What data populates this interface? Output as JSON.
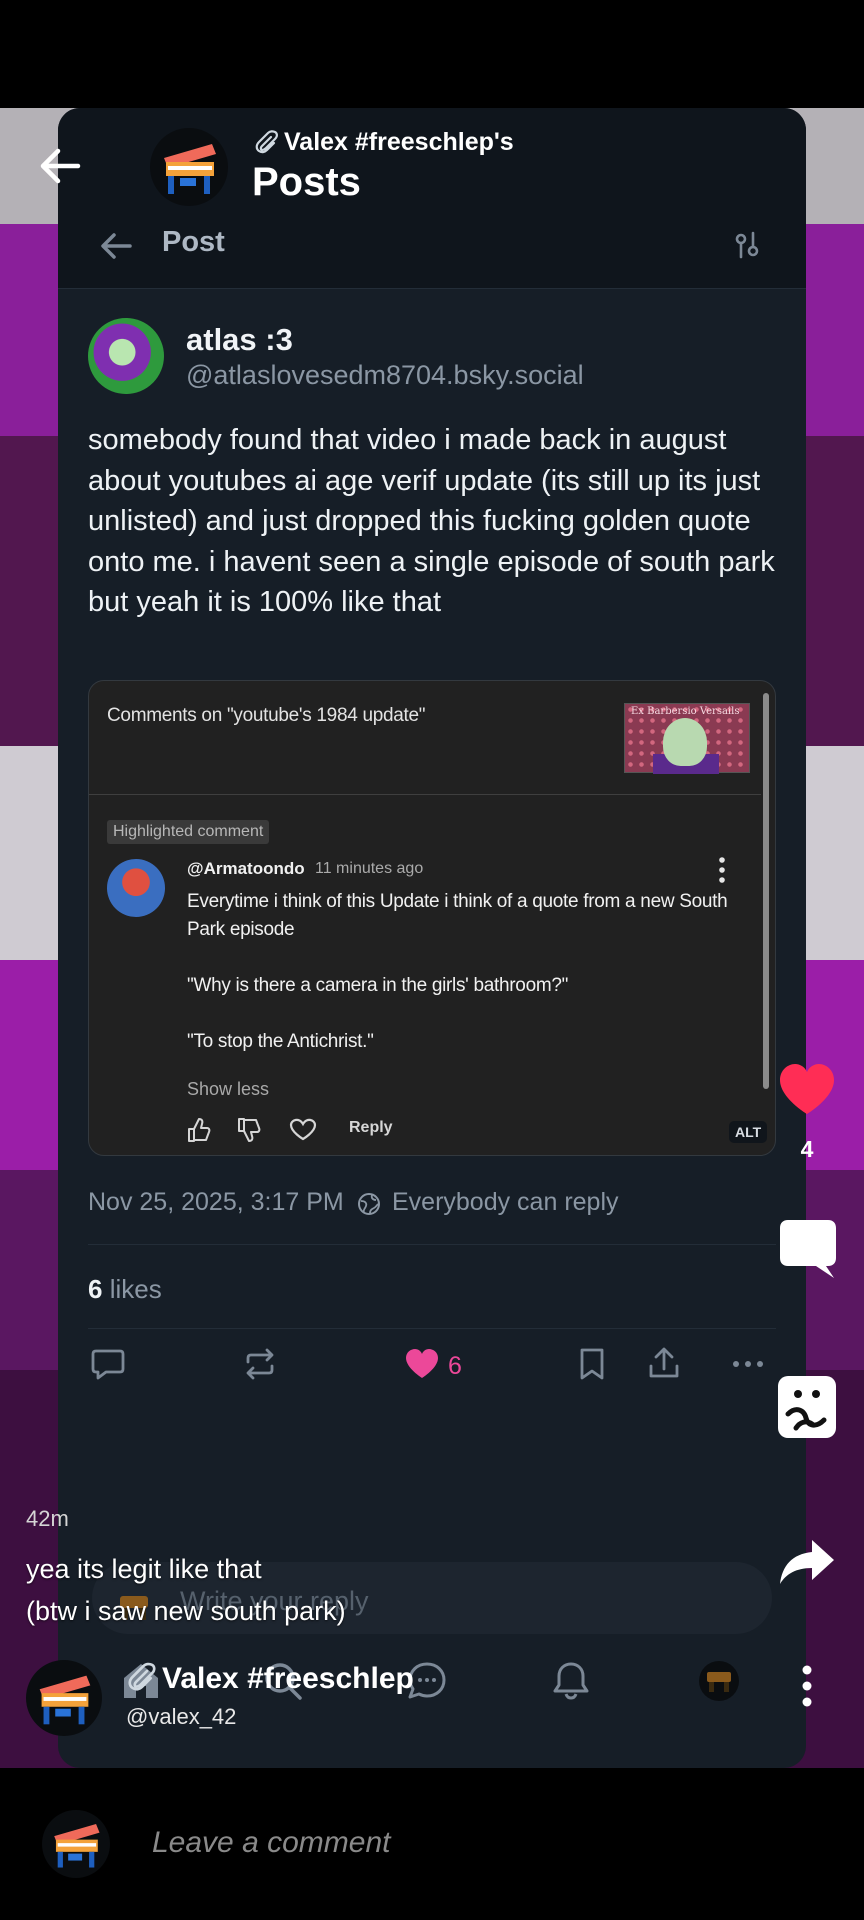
{
  "header": {
    "account_name": "Valex #freeschlep's",
    "title": "Posts"
  },
  "post_view": {
    "nav_title": "Post",
    "author": {
      "name": "atlas :3",
      "handle": "@atlaslovesedm8704.bsky.social"
    },
    "text": "somebody found that video i made back in august about youtubes ai age verif update (its still up its just unlisted) and just dropped this fucking golden quote onto me. i havent seen a single episode of south park but yeah it is 100% like that",
    "embed": {
      "header": "Comments on \"youtube's 1984 update\"",
      "thumb_text": "Ex Barbersio Versails",
      "badge": "Highlighted comment",
      "comment_author": "@Armatoondo",
      "comment_time": "11 minutes ago",
      "comment_lines": [
        "Everytime i think of this Update i think of a quote from a new South Park episode",
        "\"Why is there a camera in the girls' bathroom?\"",
        "\"To stop the Antichrist.\""
      ],
      "show_less": "Show less",
      "reply_label": "Reply",
      "alt_label": "ALT"
    },
    "date": "Nov 25, 2025, 3:17 PM",
    "reply_setting": "Everybody can reply",
    "likes_count": "6",
    "likes_label": "likes",
    "like_action_count": "6",
    "reply_placeholder": "Write your reply"
  },
  "overlay": {
    "like_count": "4",
    "timestamp": "42m",
    "caption_line1": "yea its legit like that",
    "caption_line2": "(btw i saw new south park)",
    "creator_name": "Valex #freeschlep",
    "creator_handle": "@valex_42",
    "comment_placeholder": "Leave a comment"
  },
  "colors": {
    "heart": "#ff2d55",
    "bsky_like": "#ec4899",
    "card_bg": "#161e27",
    "bg_purple": "#a020a8"
  }
}
